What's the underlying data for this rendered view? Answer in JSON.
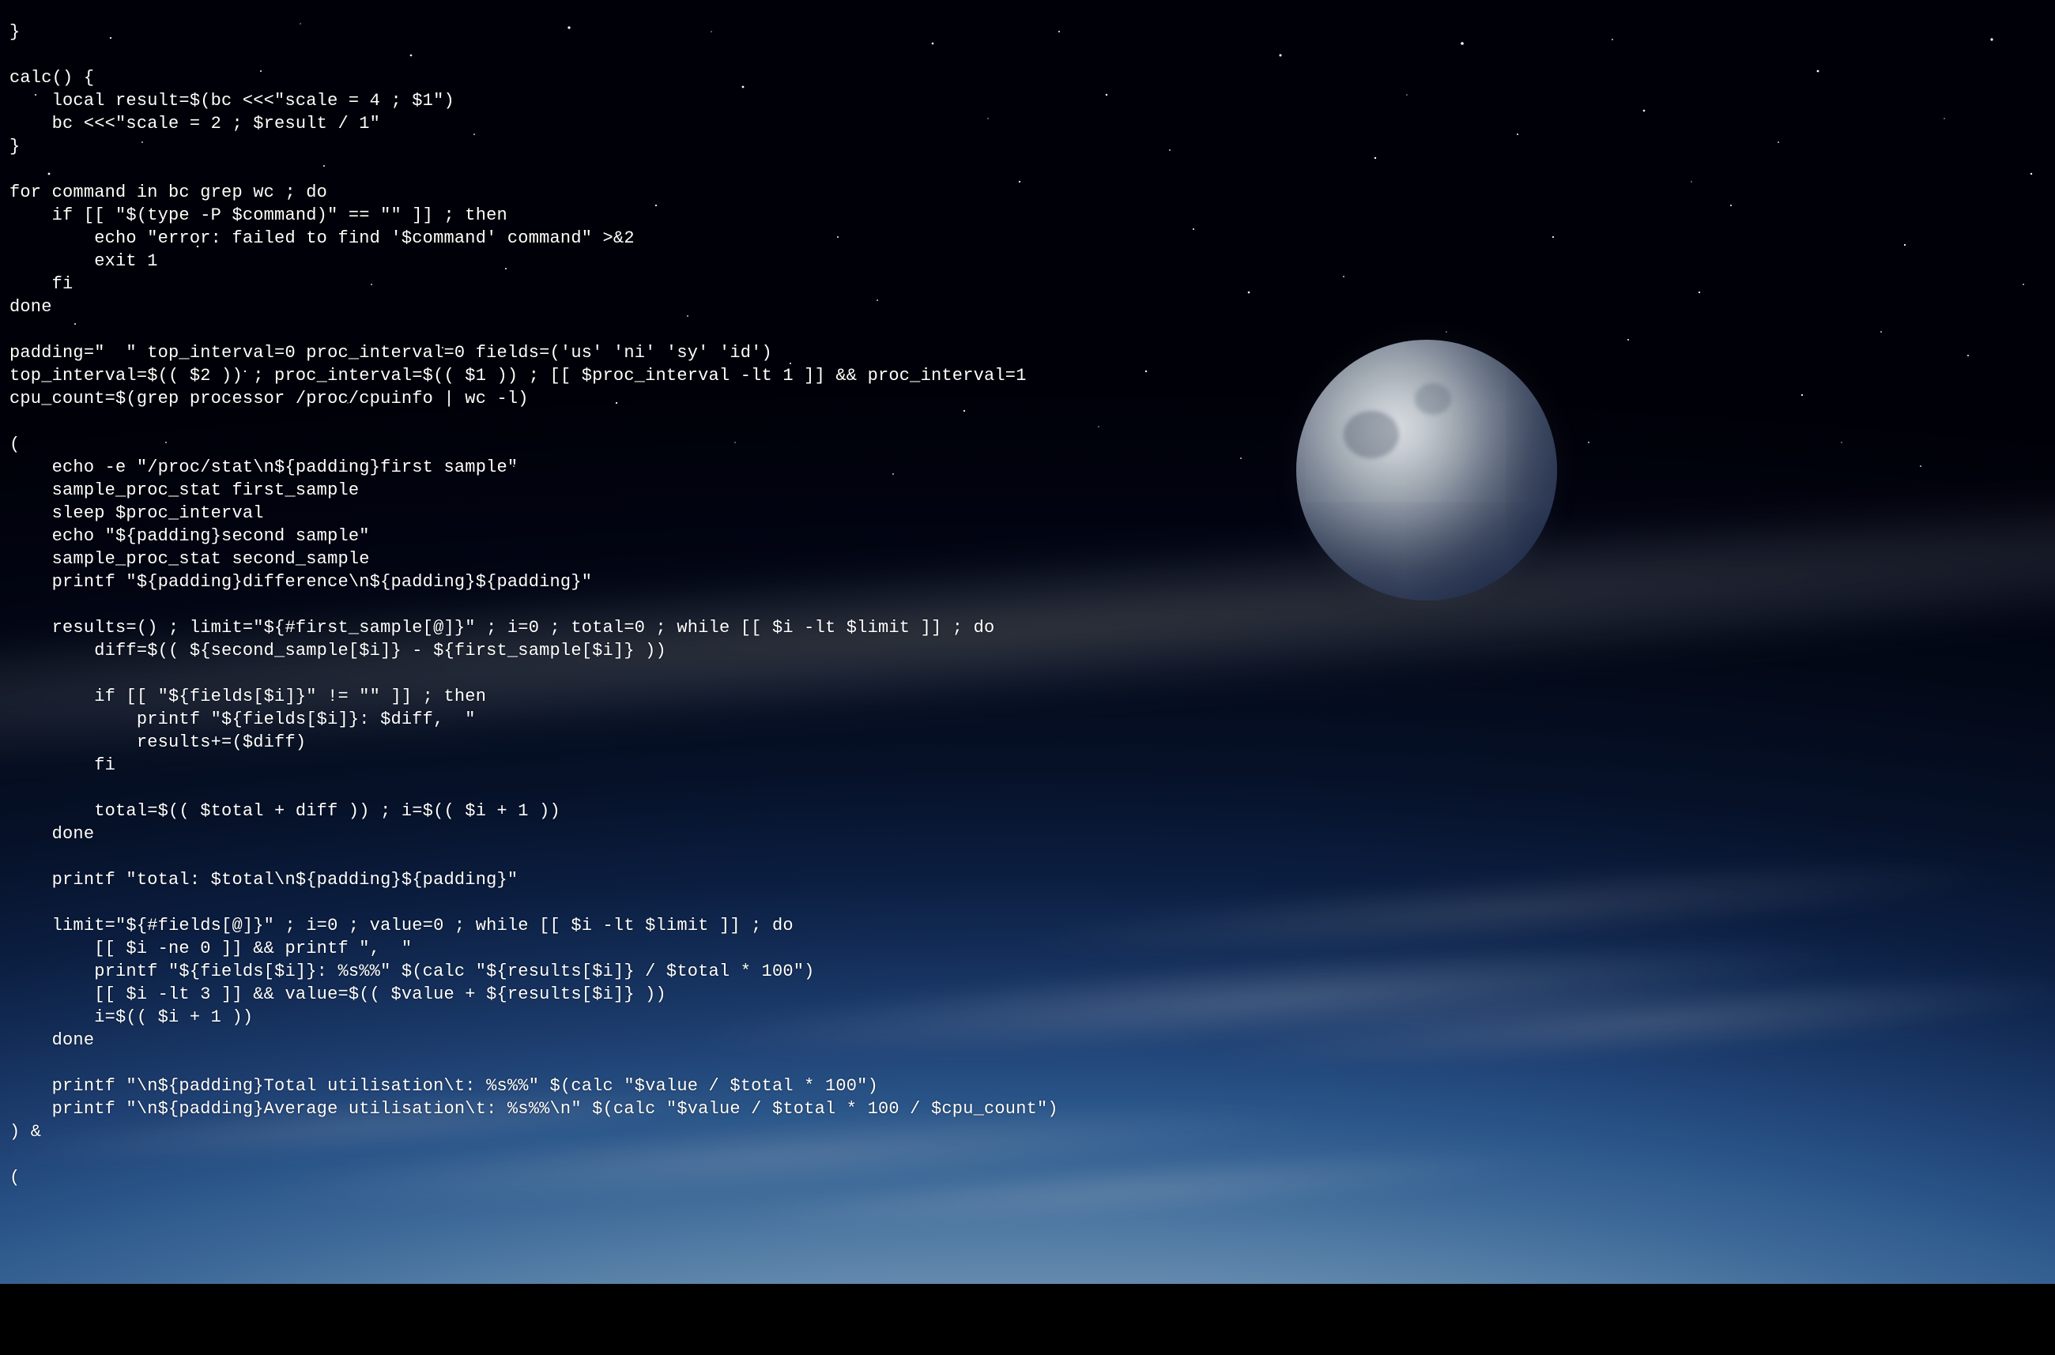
{
  "desktop": {
    "wallpaper_description": "Earth atmosphere from orbit with moon and starfield"
  },
  "terminal": {
    "code": "}\n\ncalc() {\n    local result=$(bc <<<\"scale = 4 ; $1\")\n    bc <<<\"scale = 2 ; $result / 1\"\n}\n\nfor command in bc grep wc ; do\n    if [[ \"$(type -P $command)\" == \"\" ]] ; then\n        echo \"error: failed to find '$command' command\" >&2\n        exit 1\n    fi\ndone\n\npadding=\"  \" top_interval=0 proc_interval=0 fields=('us' 'ni' 'sy' 'id')\ntop_interval=$(( $2 )) ; proc_interval=$(( $1 )) ; [[ $proc_interval -lt 1 ]] && proc_interval=1\ncpu_count=$(grep processor /proc/cpuinfo | wc -l)\n\n(\n    echo -e \"/proc/stat\\n${padding}first sample\"\n    sample_proc_stat first_sample\n    sleep $proc_interval\n    echo \"${padding}second sample\"\n    sample_proc_stat second_sample\n    printf \"${padding}difference\\n${padding}${padding}\"\n\n    results=() ; limit=\"${#first_sample[@]}\" ; i=0 ; total=0 ; while [[ $i -lt $limit ]] ; do\n        diff=$(( ${second_sample[$i]} - ${first_sample[$i]} ))\n\n        if [[ \"${fields[$i]}\" != \"\" ]] ; then\n            printf \"${fields[$i]}: $diff,  \"\n            results+=($diff)\n        fi\n\n        total=$(( $total + diff )) ; i=$(( $i + 1 ))\n    done\n\n    printf \"total: $total\\n${padding}${padding}\"\n\n    limit=\"${#fields[@]}\" ; i=0 ; value=0 ; while [[ $i -lt $limit ]] ; do\n        [[ $i -ne 0 ]] && printf \",  \"\n        printf \"${fields[$i]}: %s%%\" $(calc \"${results[$i]} / $total * 100\")\n        [[ $i -lt 3 ]] && value=$(( $value + ${results[$i]} ))\n        i=$(( $i + 1 ))\n    done\n\n    printf \"\\n${padding}Total utilisation\\t: %s%%\" $(calc \"$value / $total * 100\")\n    printf \"\\n${padding}Average utilisation\\t: %s%%\\n\" $(calc \"$value / $total * 100 / $cpu_count\")\n) &\n\n("
  }
}
